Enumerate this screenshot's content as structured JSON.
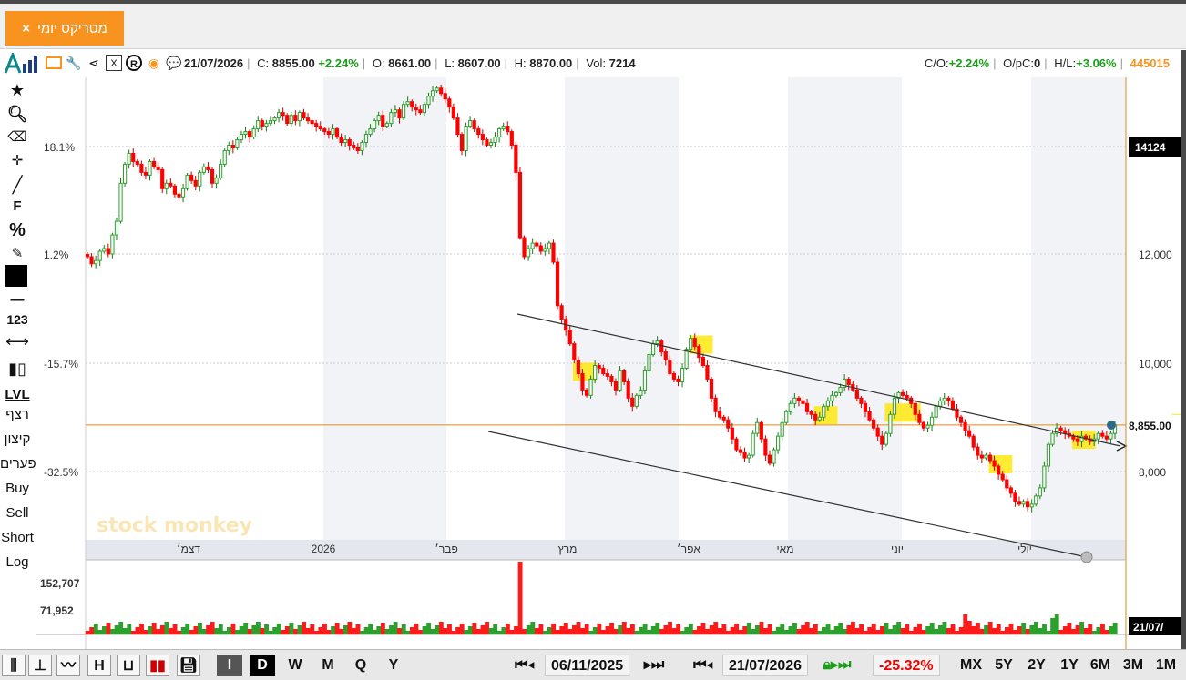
{
  "tab": {
    "label": "מטריקס יומי",
    "close": "×"
  },
  "infobar": {
    "date": "21/07/2026",
    "close_label": "C:",
    "close_value": "8855.00",
    "change": "+2.24%",
    "open_label": "O:",
    "open_value": "8661.00",
    "low_label": "L:",
    "low_value": "8607.00",
    "high_label": "H:",
    "high_value": "8870.00",
    "vol_label": "Vol:",
    "vol_value": "7214",
    "co_label": "C/O:",
    "co_value": "+2.24%",
    "opc_label": "O/pC:",
    "opc_value": "0",
    "hl_label": "H/L:",
    "hl_value": "+3.06%",
    "symbol_id": "445015"
  },
  "sidebar": {
    "f_label": "F",
    "pct_label": "%",
    "num_label": "123",
    "lvl_label": "LVL",
    "items": [
      "רצף",
      "קיצון",
      "פערים",
      "Buy",
      "Sell",
      "Short",
      "Log"
    ]
  },
  "watermark": "stock monkey",
  "colors": {
    "up": "#2ca02c",
    "down": "#ff0000",
    "accent": "#f7931e",
    "highlight": "#ffe600"
  },
  "chart_data": {
    "type": "candlestick",
    "y_right_ticks": [
      "14124",
      "12,000",
      "10,000",
      "8,000"
    ],
    "y_left_ticks": [
      "18.1%",
      "1.2%",
      "-15.7%",
      "-32.5%"
    ],
    "x_labels": [
      "דצמ׳",
      "2026",
      "פבר׳",
      "מרץ",
      "אפר׳",
      "מאי",
      "יוני",
      "יולי"
    ],
    "last_price_label": "8,855.00",
    "last_price": 8855,
    "ylim": [
      6900,
      14900
    ],
    "closes": [
      11950,
      11820,
      11880,
      12050,
      12100,
      12000,
      12350,
      12600,
      13300,
      13650,
      13850,
      13700,
      13650,
      13500,
      13450,
      13700,
      13600,
      13550,
      13200,
      13300,
      13250,
      13100,
      13050,
      13200,
      13450,
      13350,
      13250,
      13500,
      13600,
      13550,
      13300,
      13400,
      13650,
      13900,
      14000,
      13950,
      14100,
      14200,
      14250,
      14150,
      14300,
      14450,
      14350,
      14400,
      14450,
      14500,
      14600,
      14550,
      14400,
      14550,
      14450,
      14600,
      14500,
      14450,
      14400,
      14350,
      14300,
      14250,
      14200,
      14300,
      14150,
      14050,
      14100,
      14000,
      13950,
      13900,
      14050,
      14200,
      14300,
      14450,
      14550,
      14350,
      14400,
      14600,
      14650,
      14500,
      14750,
      14800,
      14700,
      14650,
      14600,
      14750,
      14900,
      15000,
      15050,
      14950,
      14850,
      14700,
      14500,
      14200,
      13900,
      14350,
      14450,
      14300,
      14200,
      14100,
      14000,
      14050,
      14150,
      14300,
      14350,
      14250,
      14000,
      13500,
      12300,
      11950,
      12100,
      12200,
      12150,
      12050,
      12100,
      12200,
      11850,
      11050,
      10800,
      10600,
      10350,
      10050,
      9800,
      9500,
      9400,
      9700,
      9950,
      9900,
      9800,
      9750,
      9650,
      9500,
      9850,
      9650,
      9350,
      9200,
      9400,
      9500,
      9850,
      10150,
      10350,
      10400,
      10200,
      10050,
      9800,
      9700,
      9650,
      9900,
      10250,
      10450,
      10300,
      10100,
      9950,
      9700,
      9350,
      9100,
      9000,
      8950,
      8800,
      8600,
      8400,
      8350,
      8250,
      8300,
      8700,
      8900,
      8600,
      8300,
      8150,
      8400,
      8650,
      8900,
      9100,
      9250,
      9350,
      9300,
      9250,
      9100,
      9050,
      8950,
      9000,
      9200,
      9300,
      9400,
      9450,
      9550,
      9700,
      9600,
      9500,
      9350,
      9250,
      9100,
      8950,
      8800,
      8650,
      8500,
      8700,
      9050,
      9350,
      9450,
      9400,
      9350,
      9250,
      9050,
      8900,
      8800,
      8850,
      9000,
      9200,
      9300,
      9350,
      9300,
      9150,
      9000,
      8900,
      8750,
      8650,
      8450,
      8300,
      8250,
      8300,
      8200,
      8100,
      7950,
      7850,
      7700,
      7600,
      7450,
      7400,
      7450,
      7350,
      7400,
      7550,
      7700,
      8100,
      8500,
      8700,
      8800,
      8750,
      8700,
      8650,
      8600,
      8550,
      8650,
      8600,
      8550,
      8600,
      8700,
      8650,
      8600,
      8700,
      8855
    ],
    "volume_ticks": [
      "152,707",
      "71,952"
    ],
    "volume_peak_label": "21/07/",
    "trend_upper": {
      "from": [
        [
          0.55,
          10500
        ]
      ],
      "to": [
        [
          1.0,
          8400
        ]
      ]
    },
    "trend_lower": {
      "from": [
        [
          0.52,
          8950
        ]
      ],
      "to": [
        [
          1.0,
          5900
        ]
      ]
    }
  },
  "bottombar": {
    "periods": [
      "I",
      "D",
      "W",
      "M",
      "Q",
      "Y"
    ],
    "start_date": "06/11/2025",
    "end_date": "21/07/2026",
    "change_pct": "-25.32%",
    "ranges": [
      "MX",
      "5Y",
      "2Y",
      "1Y",
      "6M",
      "3M",
      "1M"
    ]
  }
}
